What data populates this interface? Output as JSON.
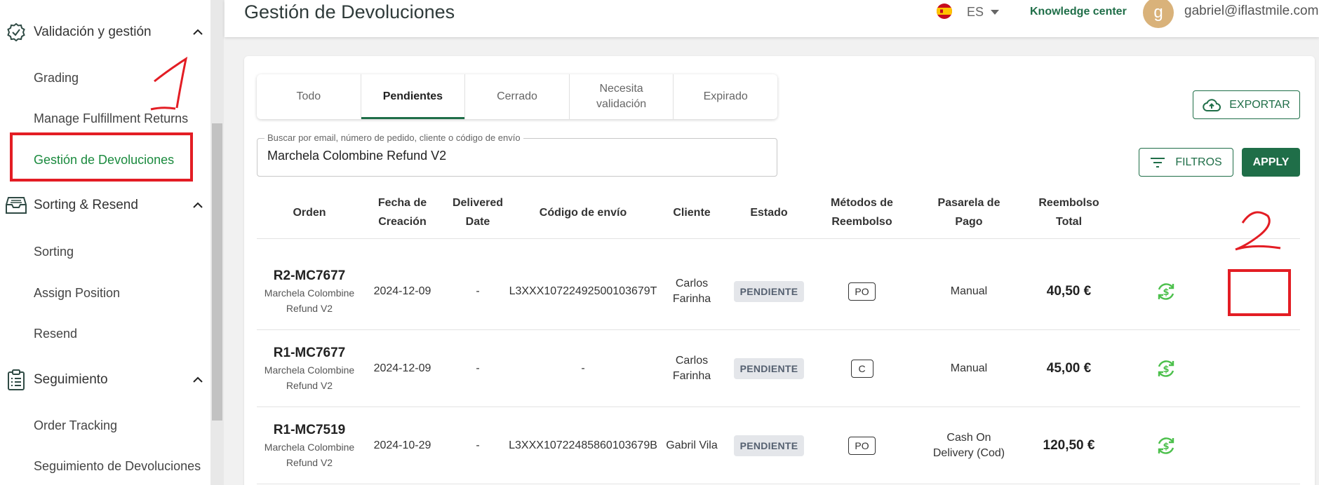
{
  "sidebar": {
    "sections": [
      {
        "label": "Validación y gestión",
        "icon": "check-badge-icon"
      },
      {
        "label": "Sorting & Resend",
        "icon": "inbox-tray-icon"
      },
      {
        "label": "Seguimiento",
        "icon": "clipboard-list-icon"
      }
    ],
    "items": [
      {
        "label": "Grading"
      },
      {
        "label": "Manage Fulfillment Returns"
      },
      {
        "label": "Gestión de Devoluciones"
      },
      {
        "label": "Sorting"
      },
      {
        "label": "Assign Position"
      },
      {
        "label": "Resend"
      },
      {
        "label": "Order Tracking"
      },
      {
        "label": "Seguimiento de Devoluciones"
      }
    ]
  },
  "annotations": {
    "mark1": "1",
    "mark2": "2"
  },
  "header": {
    "title": "Gestión de Devoluciones",
    "language": "ES",
    "knowledge_center": "Knowledge center",
    "avatar_letter": "g",
    "email": "gabriel@iflastmile.com"
  },
  "tabs": [
    {
      "label": "Todo"
    },
    {
      "label": "Pendientes"
    },
    {
      "label": "Cerrado"
    },
    {
      "label_line1": "Necesita",
      "label_line2": "validación"
    },
    {
      "label": "Expirado"
    }
  ],
  "search": {
    "label": "Buscar por email, número de pedido, cliente o código de envío",
    "value": "Marchela Colombine Refund V2"
  },
  "buttons": {
    "export": "EXPORTAR",
    "filters": "FILTROS",
    "apply": "APPLY"
  },
  "table": {
    "headers": [
      {
        "l1": "Orden",
        "l2": ""
      },
      {
        "l1": "Fecha de",
        "l2": "Creación"
      },
      {
        "l1": "Delivered",
        "l2": "Date"
      },
      {
        "l1": "Código de envío",
        "l2": ""
      },
      {
        "l1": "Cliente",
        "l2": ""
      },
      {
        "l1": "Estado",
        "l2": ""
      },
      {
        "l1": "Métodos de",
        "l2": "Reembolso"
      },
      {
        "l1": "Pasarela de",
        "l2": "Pago"
      },
      {
        "l1": "Reembolso",
        "l2": "Total"
      }
    ],
    "rows": [
      {
        "order": "R2-MC7677",
        "sub1": "Marchela Colombine",
        "sub2": "Refund V2",
        "created": "2024-12-09",
        "delivered": "-",
        "shipping": "L3XXX10722492500103679T",
        "client1": "Carlos",
        "client2": "Farinha",
        "status": "PENDIENTE",
        "method": "PO",
        "gateway1": "Manual",
        "gateway2": "",
        "total": "40,50 €"
      },
      {
        "order": "R1-MC7677",
        "sub1": "Marchela Colombine",
        "sub2": "Refund V2",
        "created": "2024-12-09",
        "delivered": "-",
        "shipping": "-",
        "client1": "Carlos",
        "client2": "Farinha",
        "status": "PENDIENTE",
        "method": "C",
        "gateway1": "Manual",
        "gateway2": "",
        "total": "45,00 €"
      },
      {
        "order": "R1-MC7519",
        "sub1": "Marchela Colombine",
        "sub2": "Refund V2",
        "created": "2024-10-29",
        "delivered": "-",
        "shipping": "L3XXX10722485860103679B",
        "client1": "Gabril Vila",
        "client2": "",
        "status": "PENDIENTE",
        "method": "PO",
        "gateway1": "Cash On",
        "gateway2": "Delivery (Cod)",
        "total": "120,50 €"
      }
    ]
  },
  "colors": {
    "brand_green": "#1f6e48",
    "active_green": "#1a8a3e",
    "annotation_red": "#e31d24",
    "refund_icon": "#4cc04c"
  }
}
